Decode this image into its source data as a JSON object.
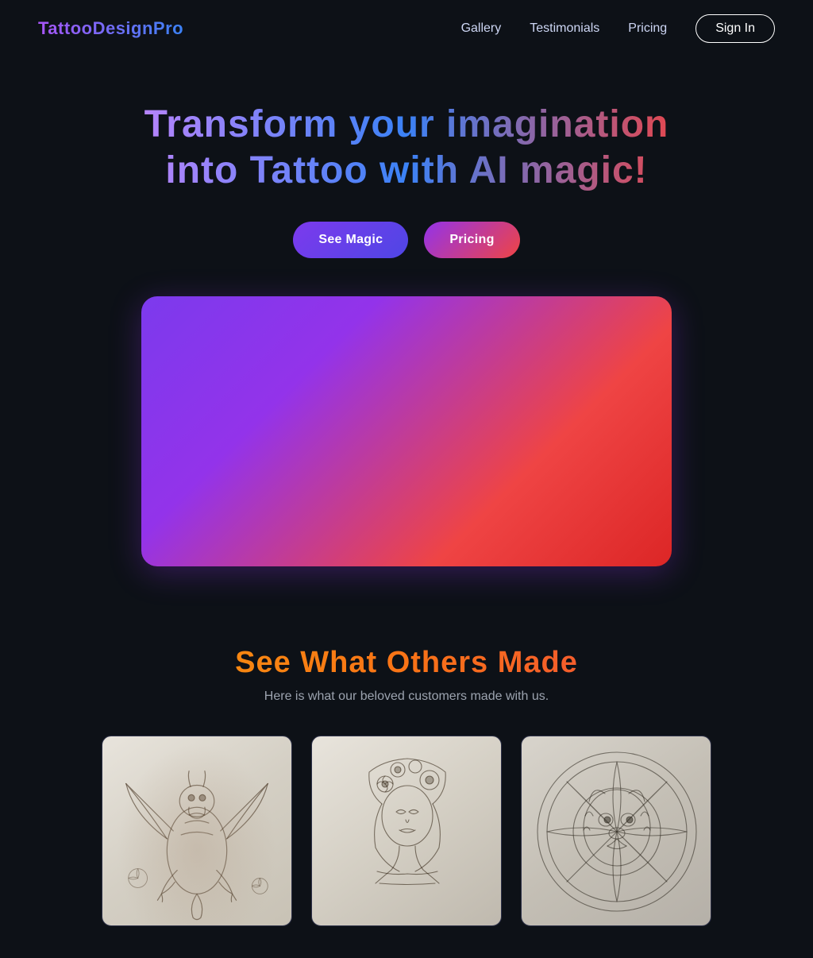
{
  "nav": {
    "logo": "TattooDesignPro",
    "links": [
      {
        "id": "gallery",
        "label": "Gallery"
      },
      {
        "id": "testimonials",
        "label": "Testimonials"
      },
      {
        "id": "pricing",
        "label": "Pricing"
      }
    ],
    "signin_label": "Sign In"
  },
  "hero": {
    "title": "Transform your imagination into Tattoo with AI magic!",
    "cta_magic": "See Magic",
    "cta_pricing": "Pricing"
  },
  "gallery": {
    "title": "See What Others Made",
    "subtitle": "Here is what our beloved customers made with us.",
    "cards": [
      {
        "id": "dragon",
        "alt": "Dragon tattoo sketch"
      },
      {
        "id": "woman",
        "alt": "Woman with flowers tattoo sketch"
      },
      {
        "id": "wolf",
        "alt": "Wolf mandala tattoo sketch"
      }
    ]
  }
}
